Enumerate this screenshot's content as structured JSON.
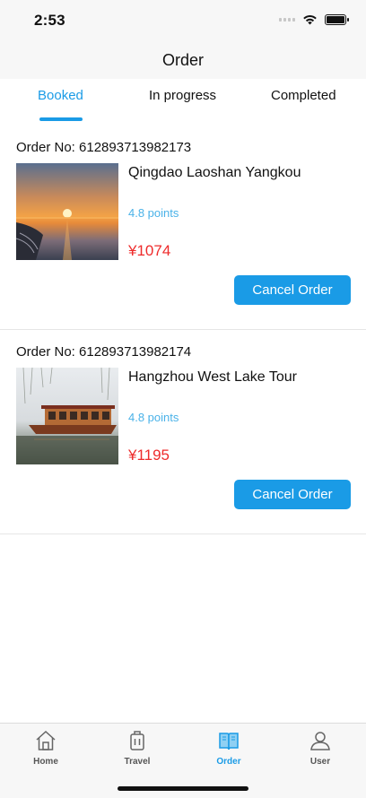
{
  "status_bar": {
    "time": "2:53"
  },
  "header": {
    "title": "Order"
  },
  "tabs": [
    {
      "label": "Booked",
      "active": true
    },
    {
      "label": "In progress",
      "active": false
    },
    {
      "label": "Completed",
      "active": false
    }
  ],
  "orders": [
    {
      "order_no": "Order No: 612893713982173",
      "title": "Qingdao Laoshan Yangkou",
      "rating": "4.8 points",
      "price": "¥1074",
      "cancel_label": "Cancel Order"
    },
    {
      "order_no": "Order No: 612893713982174",
      "title": "Hangzhou West Lake Tour",
      "rating": "4.8 points",
      "price": "¥1195",
      "cancel_label": "Cancel Order"
    }
  ],
  "tab_bar": {
    "items": [
      {
        "label": "Home",
        "icon": "home-icon",
        "active": false
      },
      {
        "label": "Travel",
        "icon": "luggage-icon",
        "active": false
      },
      {
        "label": "Order",
        "icon": "book-icon",
        "active": true
      },
      {
        "label": "User",
        "icon": "user-icon",
        "active": false
      }
    ]
  },
  "colors": {
    "accent": "#1a9be6",
    "price": "#ee2b2b",
    "rating": "#4ab2e8"
  }
}
